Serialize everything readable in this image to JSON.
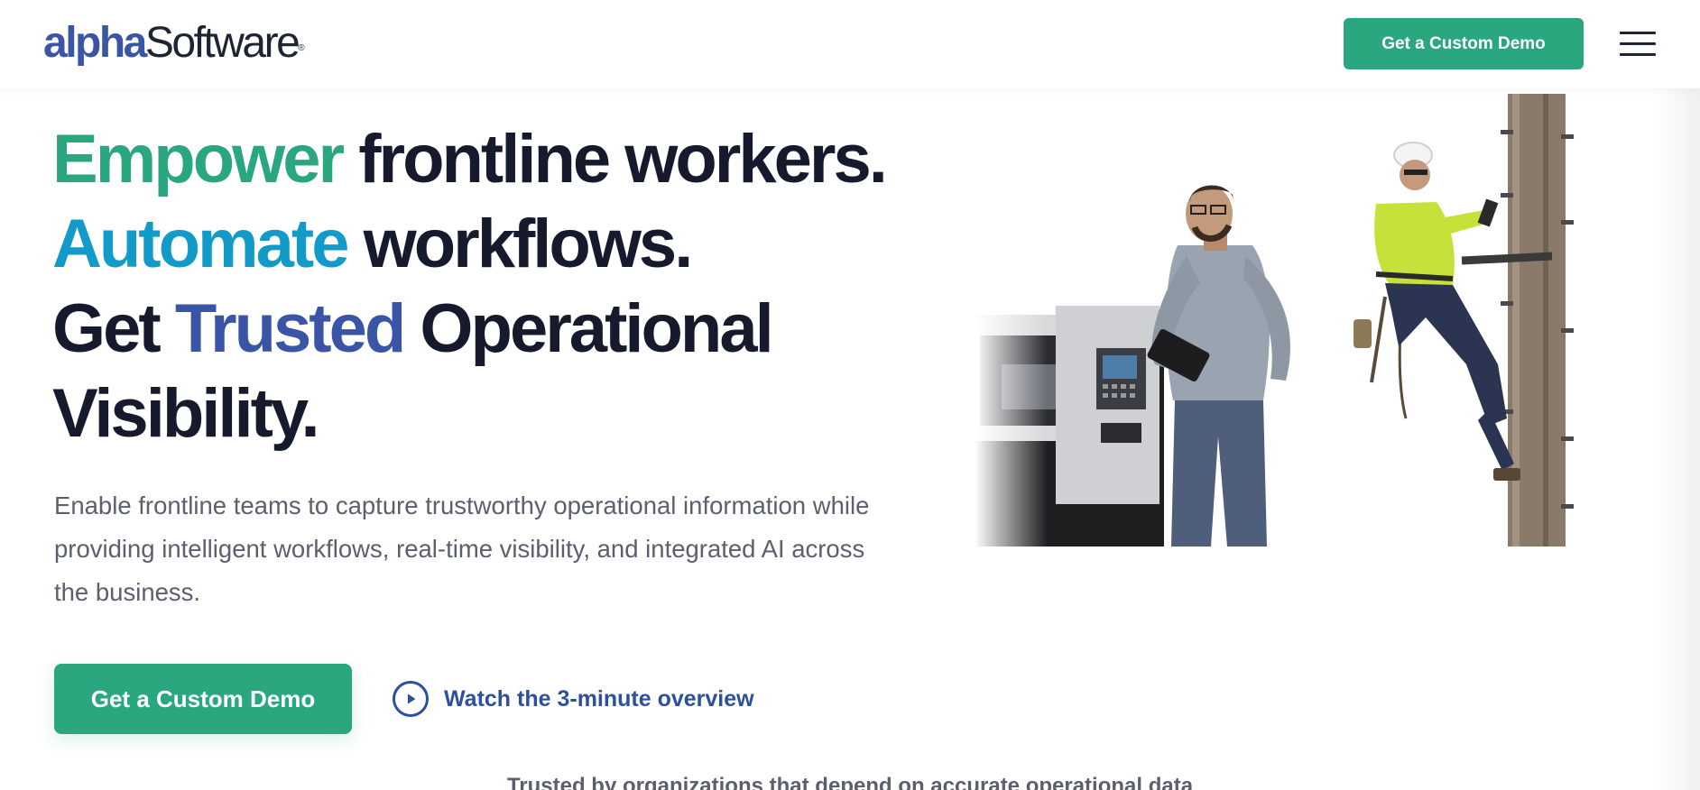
{
  "header": {
    "logo": {
      "alpha": "alpha",
      "software": "Software",
      "reg": "®"
    },
    "cta_label": "Get a Custom Demo",
    "menu_icon": "hamburger-menu-icon"
  },
  "hero": {
    "line1": {
      "highlight": "Empower",
      "rest": " frontline workers."
    },
    "line2": {
      "highlight": "Automate",
      "rest": " workflows."
    },
    "line3": {
      "start": "Get ",
      "highlight": "Trusted",
      "rest": " Operational"
    },
    "line4": "Visibility.",
    "description": "Enable frontline teams to capture trustworthy operational information while providing intelligent workflows, real-time visibility, and integrated AI across the business.",
    "cta_label": "Get a Custom Demo",
    "watch_label": "Watch the 3-minute overview",
    "watch_icon": "play-circle-icon"
  },
  "trusted": "Trusted by organizations that depend on accurate operational data",
  "colors": {
    "brand_green": "#2aa77e",
    "brand_cyan": "#129ac9",
    "brand_blue": "#3b55a6",
    "link_blue": "#2c4f9e",
    "heading": "#161a2c",
    "body_text": "#5b5f6e"
  }
}
